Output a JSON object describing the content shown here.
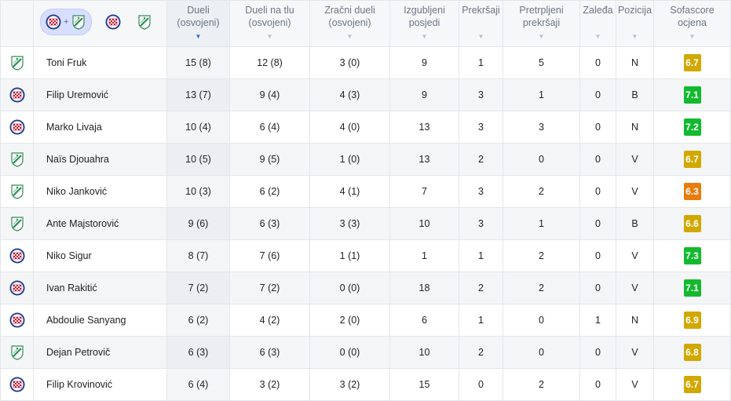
{
  "columns": [
    {
      "key": "duels",
      "label": "Dueli (osvojeni)",
      "sorted": true
    },
    {
      "key": "ground",
      "label": "Dueli na tlu (osvojeni)",
      "sorted": false
    },
    {
      "key": "aerial",
      "label": "Zračni dueli (osvojeni)",
      "sorted": false
    },
    {
      "key": "lost",
      "label": "Izgubljeni posjedi",
      "sorted": false
    },
    {
      "key": "fouls",
      "label": "Prekršaji",
      "sorted": false
    },
    {
      "key": "fouled",
      "label": "Pretrpljeni prekršaji",
      "sorted": false
    },
    {
      "key": "offsides",
      "label": "Zaleđa",
      "sorted": false
    },
    {
      "key": "position",
      "label": "Pozicija",
      "sorted": false
    },
    {
      "key": "rating",
      "label": "Sofascore ocjena",
      "sorted": false
    }
  ],
  "filter": {
    "both_teams_plus": "+",
    "team_icons": [
      "hajduk-crest-icon",
      "osijek-crest-icon"
    ]
  },
  "rating_colors": {
    "orange": "#e87c0c",
    "yellow": "#d1a800",
    "green": "#13b92f"
  },
  "players": [
    {
      "team": "osijek",
      "name": "Toni Fruk",
      "duels": "15 (8)",
      "ground": "12 (8)",
      "aerial": "3 (0)",
      "lost": "9",
      "fouls": "1",
      "fouled": "5",
      "offsides": "0",
      "position": "N",
      "rating": "6.7",
      "rating_color": "yellow"
    },
    {
      "team": "hajduk",
      "name": "Filip Uremović",
      "duels": "13 (7)",
      "ground": "9 (4)",
      "aerial": "4 (3)",
      "lost": "9",
      "fouls": "3",
      "fouled": "1",
      "offsides": "0",
      "position": "B",
      "rating": "7.1",
      "rating_color": "green"
    },
    {
      "team": "hajduk",
      "name": "Marko Livaja",
      "duels": "10 (4)",
      "ground": "6 (4)",
      "aerial": "4 (0)",
      "lost": "13",
      "fouls": "3",
      "fouled": "3",
      "offsides": "0",
      "position": "N",
      "rating": "7.2",
      "rating_color": "green"
    },
    {
      "team": "osijek",
      "name": "Naïs Djouahra",
      "duels": "10 (5)",
      "ground": "9 (5)",
      "aerial": "1 (0)",
      "lost": "13",
      "fouls": "2",
      "fouled": "0",
      "offsides": "0",
      "position": "V",
      "rating": "6.7",
      "rating_color": "yellow"
    },
    {
      "team": "osijek",
      "name": "Niko Janković",
      "duels": "10 (3)",
      "ground": "6 (2)",
      "aerial": "4 (1)",
      "lost": "7",
      "fouls": "3",
      "fouled": "2",
      "offsides": "0",
      "position": "V",
      "rating": "6.3",
      "rating_color": "orange"
    },
    {
      "team": "osijek",
      "name": "Ante Majstorović",
      "duels": "9 (6)",
      "ground": "6 (3)",
      "aerial": "3 (3)",
      "lost": "10",
      "fouls": "3",
      "fouled": "1",
      "offsides": "0",
      "position": "B",
      "rating": "6.6",
      "rating_color": "yellow"
    },
    {
      "team": "hajduk",
      "name": "Niko Sigur",
      "duels": "8 (7)",
      "ground": "7 (6)",
      "aerial": "1 (1)",
      "lost": "1",
      "fouls": "1",
      "fouled": "2",
      "offsides": "0",
      "position": "V",
      "rating": "7.3",
      "rating_color": "green"
    },
    {
      "team": "hajduk",
      "name": "Ivan Rakitić",
      "duels": "7 (2)",
      "ground": "7 (2)",
      "aerial": "0 (0)",
      "lost": "18",
      "fouls": "2",
      "fouled": "2",
      "offsides": "0",
      "position": "V",
      "rating": "7.1",
      "rating_color": "green"
    },
    {
      "team": "hajduk",
      "name": "Abdoulie Sanyang",
      "duels": "6 (2)",
      "ground": "4 (2)",
      "aerial": "2 (0)",
      "lost": "6",
      "fouls": "1",
      "fouled": "0",
      "offsides": "1",
      "position": "N",
      "rating": "6.9",
      "rating_color": "yellow"
    },
    {
      "team": "osijek",
      "name": "Dejan Petrovič",
      "duels": "6 (3)",
      "ground": "6 (3)",
      "aerial": "0 (0)",
      "lost": "10",
      "fouls": "2",
      "fouled": "0",
      "offsides": "0",
      "position": "V",
      "rating": "6.8",
      "rating_color": "yellow"
    },
    {
      "team": "hajduk",
      "name": "Filip Krovinović",
      "duels": "6 (4)",
      "ground": "3 (2)",
      "aerial": "3 (2)",
      "lost": "15",
      "fouls": "0",
      "fouled": "2",
      "offsides": "0",
      "position": "V",
      "rating": "6.7",
      "rating_color": "yellow"
    }
  ]
}
